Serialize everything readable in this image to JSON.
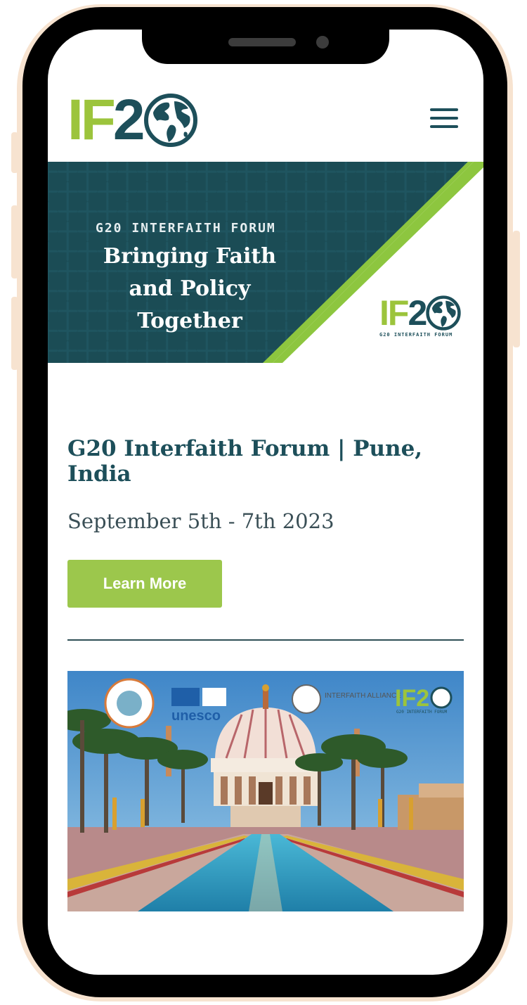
{
  "header": {
    "logo_text": "IF20",
    "menu_icon": "hamburger-menu-icon"
  },
  "hero": {
    "eyebrow": "G20 INTERFAITH FORUM",
    "title": "Bringing Faith and Policy Together",
    "logo_text": "IF20",
    "logo_subtitle": "G20 INTERFAITH FORUM",
    "colors": {
      "background": "#1b4c55",
      "accent": "#8dc63f"
    }
  },
  "event": {
    "title": "G20 Interfaith Forum | Pune, India",
    "date": "September 5th - 7th 2023",
    "cta_label": "Learn More"
  },
  "photo": {
    "partner_logos": {
      "unesco": "unesco",
      "interfaith_alliance": "INTERFAITH ALLIANCE",
      "if20": "IF20",
      "if20_sub": "G20 INTERFAITH FORUM"
    }
  },
  "colors": {
    "brand_dark": "#1d4f5a",
    "brand_green": "#9cc74c",
    "phone_frame": "#000000",
    "phone_bezel": "#f7e3d0"
  }
}
